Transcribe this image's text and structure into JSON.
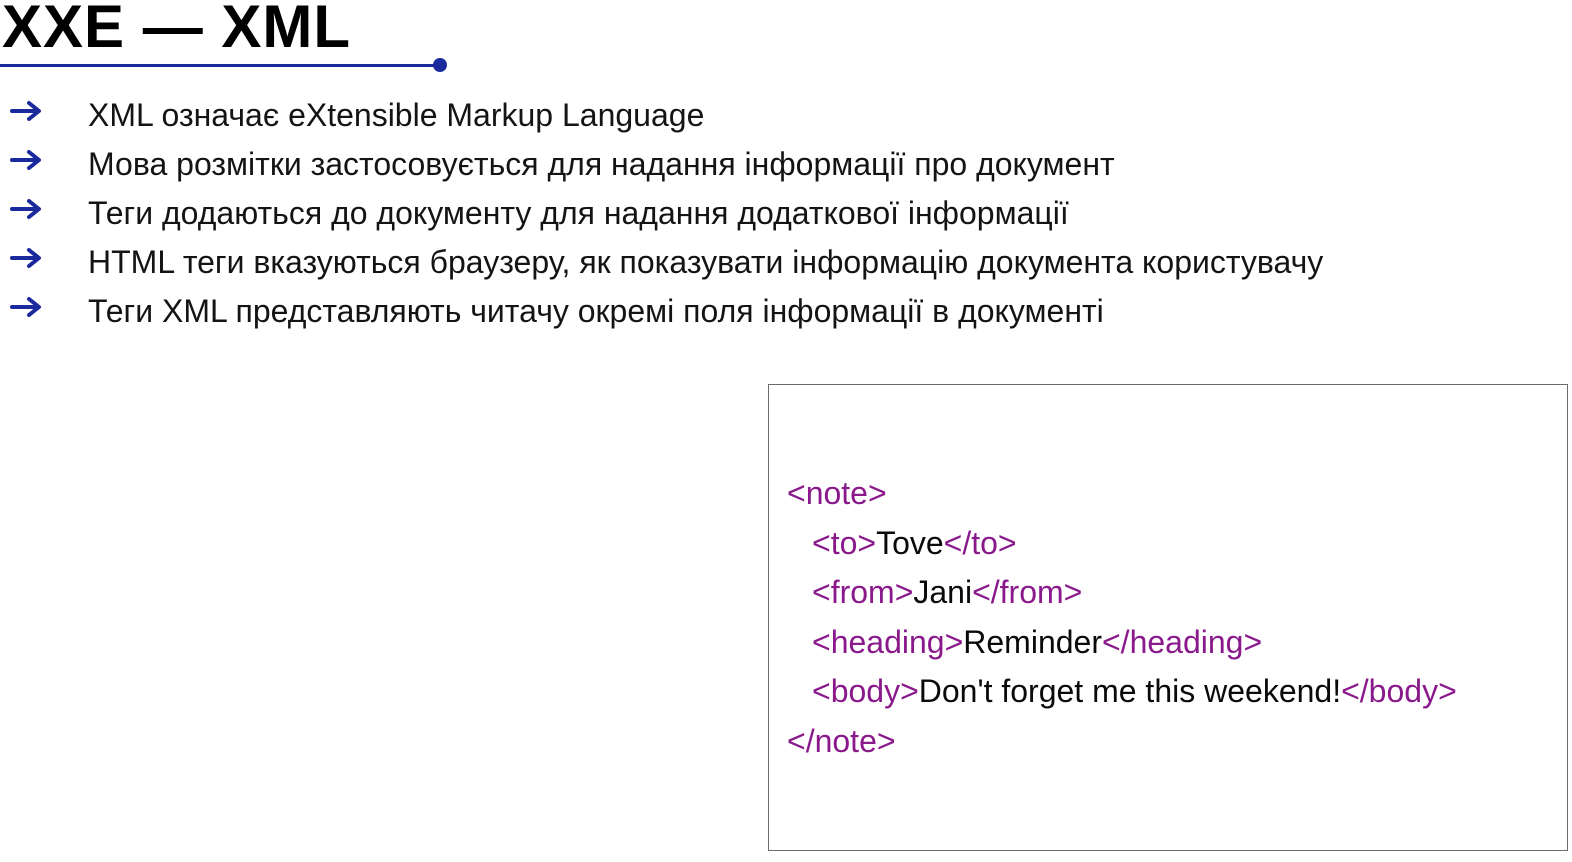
{
  "slide": {
    "title": "XXE — XML",
    "accent_color": "#1a2a9c",
    "bullet_icon": "right-arrow-icon",
    "bullets": [
      "XML означає eXtensible Markup Language",
      "Мова розмітки застосовується для надання інформації про документ",
      "Теги додаються до документу для надання додаткової інформації",
      "HTML теги вказуються браузеру, як показувати інформацію документа користувачу",
      "Теги XML представляють читачу окремі поля інформації в документі"
    ]
  },
  "code_example": {
    "tag_color": "#8a1a8c",
    "text_color": "#0a0a0a",
    "note_open": "<note>",
    "to_open": "<to>",
    "to_value": "Tove",
    "to_close": "</to>",
    "from_open": "<from>",
    "from_value": "Jani",
    "from_close": "</from>",
    "heading_open": "<heading>",
    "heading_value": "Reminder",
    "heading_close": "</heading>",
    "body_open": "<body>",
    "body_value": "Don't forget me this weekend!",
    "body_close": "</body>",
    "note_close": "</note>"
  }
}
